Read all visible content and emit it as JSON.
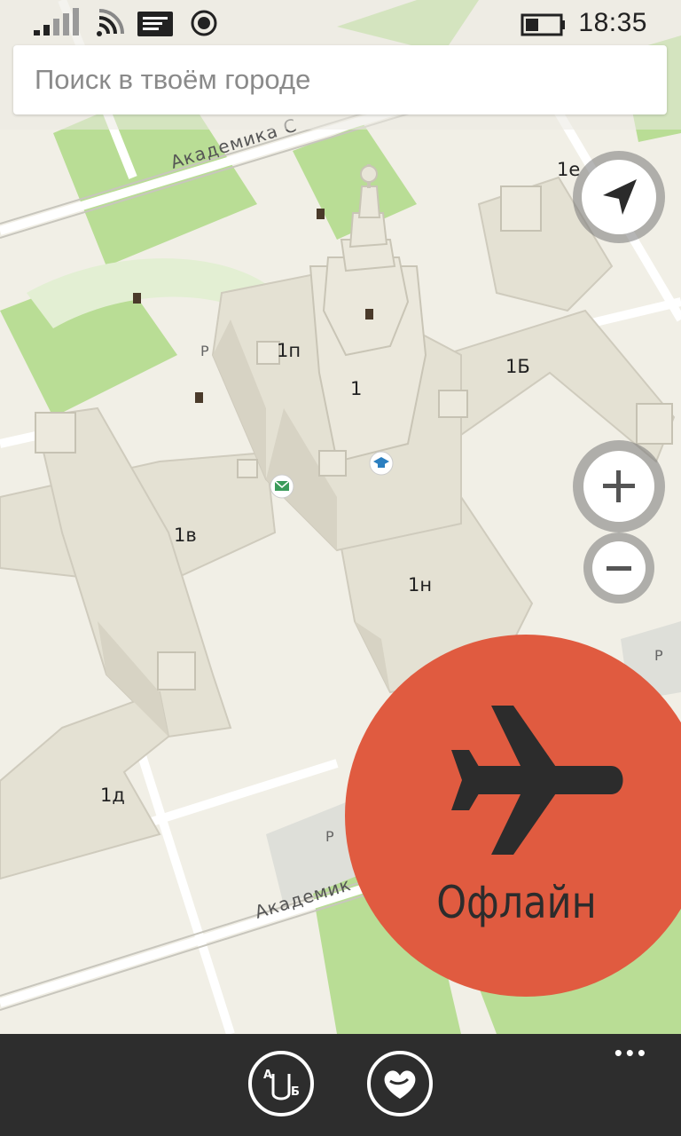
{
  "status_bar": {
    "time": "18:35"
  },
  "search": {
    "placeholder": "Поиск в твоём городе"
  },
  "map": {
    "building_labels": [
      "1п",
      "1",
      "1Б",
      "1в",
      "1н",
      "1д",
      "1е"
    ],
    "street_labels": [
      "Академика С",
      "Академик"
    ],
    "parking_label": "P"
  },
  "offline": {
    "label": "Офлайн"
  },
  "appbar": {
    "route_icon_text": [
      "А",
      "Б"
    ],
    "more": "•••"
  },
  "icons": {
    "signal": "signal-strength-icon",
    "wifi": "wifi-icon",
    "message": "message-icon",
    "location_status": "location-status-icon",
    "battery": "battery-icon",
    "navigate": "navigation-arrow-icon",
    "zoom_in": "plus-icon",
    "zoom_out": "minus-icon",
    "airplane": "airplane-icon",
    "route": "route-icon",
    "favorites": "heart-icon",
    "education": "graduation-cap-icon",
    "mail": "mail-icon"
  }
}
